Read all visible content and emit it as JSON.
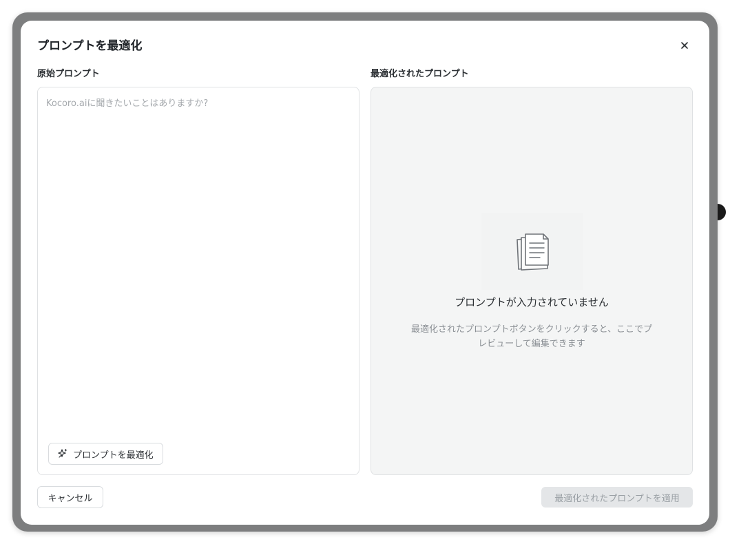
{
  "dialog": {
    "title": "プロンプトを最適化",
    "close_icon": "close-icon"
  },
  "original": {
    "label": "原始プロンプト",
    "value": "",
    "placeholder": "Kocoro.aiに聞きたいことはありますか?",
    "optimize_button_icon": "sparkle-icon",
    "optimize_button_label": "プロンプトを最適化"
  },
  "optimized": {
    "label": "最適化されたプロンプト",
    "empty_icon": "documents-icon",
    "empty_title": "プロンプトが入力されていません",
    "empty_description": "最適化されたプロンプトボタンをクリックすると、ここでプレビューして編集できます"
  },
  "footer": {
    "cancel_label": "キャンセル",
    "apply_label": "最適化されたプロンプトを適用",
    "apply_disabled": true
  }
}
